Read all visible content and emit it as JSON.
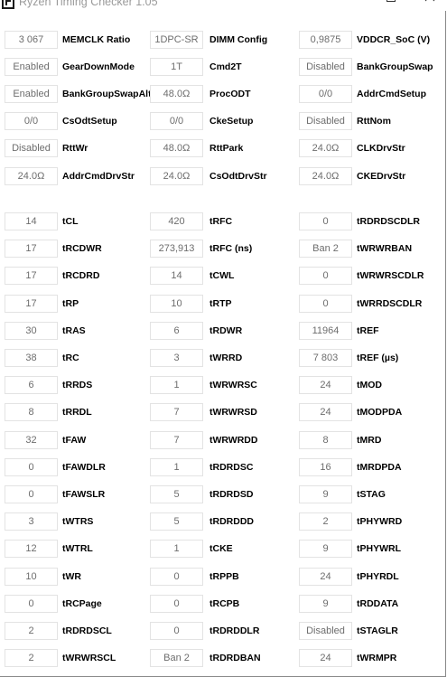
{
  "window": {
    "title": "Ryzen Timing Checker 1.05",
    "controls": {
      "minimize_icon": "minimize-icon",
      "maximize_icon": "maximize-icon",
      "close_icon": "close-icon"
    }
  },
  "config_rows": [
    [
      {
        "value": "3 067",
        "label": "MEMCLK Ratio"
      },
      {
        "value": "1DPC-SR",
        "label": "DIMM Config"
      },
      {
        "value": "0,9875",
        "label": "VDDCR_SoC (V)"
      }
    ],
    [
      {
        "value": "Enabled",
        "label": "GearDownMode"
      },
      {
        "value": "1T",
        "label": "Cmd2T"
      },
      {
        "value": "Disabled",
        "label": "BankGroupSwap"
      }
    ],
    [
      {
        "value": "Enabled",
        "label": "BankGroupSwapAlt"
      },
      {
        "value": "48.0Ω",
        "label": "ProcODT"
      },
      {
        "value": "0/0",
        "label": "AddrCmdSetup"
      }
    ],
    [
      {
        "value": "0/0",
        "label": "CsOdtSetup"
      },
      {
        "value": "0/0",
        "label": "CkeSetup"
      },
      {
        "value": "Disabled",
        "label": "RttNom"
      }
    ],
    [
      {
        "value": "Disabled",
        "label": "RttWr"
      },
      {
        "value": "48.0Ω",
        "label": "RttPark"
      },
      {
        "value": "24.0Ω",
        "label": "CLKDrvStr"
      }
    ],
    [
      {
        "value": "24.0Ω",
        "label": "AddrCmdDrvStr"
      },
      {
        "value": "24.0Ω",
        "label": "CsOdtDrvStr"
      },
      {
        "value": "24.0Ω",
        "label": "CKEDrvStr"
      }
    ]
  ],
  "timing_rows": [
    [
      {
        "value": "14",
        "label": "tCL"
      },
      {
        "value": "420",
        "label": "tRFC"
      },
      {
        "value": "0",
        "label": "tRDRDSCDLR"
      }
    ],
    [
      {
        "value": "17",
        "label": "tRCDWR"
      },
      {
        "value": "273,913",
        "label": "tRFC (ns)"
      },
      {
        "value": "Ban 2",
        "label": "tWRWRBAN"
      }
    ],
    [
      {
        "value": "17",
        "label": "tRCDRD"
      },
      {
        "value": "14",
        "label": "tCWL"
      },
      {
        "value": "0",
        "label": "tWRWRSCDLR"
      }
    ],
    [
      {
        "value": "17",
        "label": "tRP"
      },
      {
        "value": "10",
        "label": "tRTP"
      },
      {
        "value": "0",
        "label": "tWRRDSCDLR"
      }
    ],
    [
      {
        "value": "30",
        "label": "tRAS"
      },
      {
        "value": "6",
        "label": "tRDWR"
      },
      {
        "value": "11964",
        "label": "tREF"
      }
    ],
    [
      {
        "value": "38",
        "label": "tRC"
      },
      {
        "value": "3",
        "label": "tWRRD"
      },
      {
        "value": "7 803",
        "label": "tREF (µs)"
      }
    ],
    [
      {
        "value": "6",
        "label": "tRRDS"
      },
      {
        "value": "1",
        "label": "tWRWRSC"
      },
      {
        "value": "24",
        "label": "tMOD"
      }
    ],
    [
      {
        "value": "8",
        "label": "tRRDL"
      },
      {
        "value": "7",
        "label": "tWRWRSD"
      },
      {
        "value": "24",
        "label": "tMODPDA"
      }
    ],
    [
      {
        "value": "32",
        "label": "tFAW"
      },
      {
        "value": "7",
        "label": "tWRWRDD"
      },
      {
        "value": "8",
        "label": "tMRD"
      }
    ],
    [
      {
        "value": "0",
        "label": "tFAWDLR"
      },
      {
        "value": "1",
        "label": "tRDRDSC"
      },
      {
        "value": "16",
        "label": "tMRDPDA"
      }
    ],
    [
      {
        "value": "0",
        "label": "tFAWSLR"
      },
      {
        "value": "5",
        "label": "tRDRDSD"
      },
      {
        "value": "9",
        "label": "tSTAG"
      }
    ],
    [
      {
        "value": "3",
        "label": "tWTRS"
      },
      {
        "value": "5",
        "label": "tRDRDDD"
      },
      {
        "value": "2",
        "label": "tPHYWRD"
      }
    ],
    [
      {
        "value": "12",
        "label": "tWTRL"
      },
      {
        "value": "1",
        "label": "tCKE"
      },
      {
        "value": "9",
        "label": "tPHYWRL"
      }
    ],
    [
      {
        "value": "10",
        "label": "tWR"
      },
      {
        "value": "0",
        "label": "tRPPB"
      },
      {
        "value": "24",
        "label": "tPHYRDL"
      }
    ],
    [
      {
        "value": "0",
        "label": "tRCPage"
      },
      {
        "value": "0",
        "label": "tRCPB"
      },
      {
        "value": "9",
        "label": "tRDDATA"
      }
    ],
    [
      {
        "value": "2",
        "label": "tRDRDSCL"
      },
      {
        "value": "0",
        "label": "tRDRDDLR"
      },
      {
        "value": "Disabled",
        "label": "tSTAGLR"
      }
    ],
    [
      {
        "value": "2",
        "label": "tWRWRSCL"
      },
      {
        "value": "Ban 2",
        "label": "tRDRDBAN"
      },
      {
        "value": "24",
        "label": "tWRMPR"
      }
    ]
  ]
}
